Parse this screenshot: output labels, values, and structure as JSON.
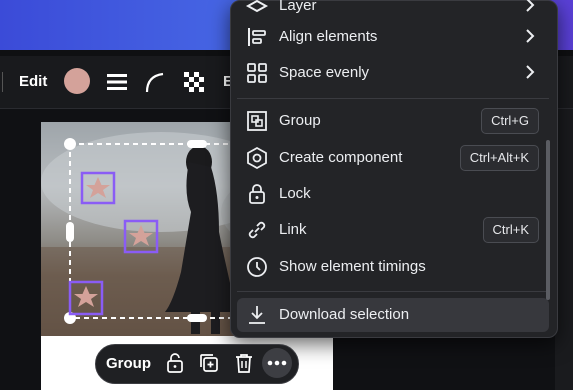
{
  "toolbar": {
    "edit_label": "Edit",
    "more_label": "E",
    "swatch_color": "#d4a29a"
  },
  "menu": {
    "partial_top_label": "Layer",
    "items": [
      {
        "label": "Align elements",
        "icon": "align-icon",
        "has_submenu": true
      },
      {
        "label": "Space evenly",
        "icon": "grid-icon",
        "has_submenu": true
      },
      {
        "label": "Group",
        "icon": "group-icon",
        "shortcut": "Ctrl+G"
      },
      {
        "label": "Create component",
        "icon": "component-icon",
        "shortcut": "Ctrl+Alt+K"
      },
      {
        "label": "Lock",
        "icon": "lock-icon"
      },
      {
        "label": "Link",
        "icon": "link-icon",
        "shortcut": "Ctrl+K"
      },
      {
        "label": "Show element timings",
        "icon": "clock-icon"
      },
      {
        "label": "Download selection",
        "icon": "download-icon",
        "highlighted": true
      }
    ]
  },
  "float_toolbar": {
    "group_label": "Group",
    "icons": [
      "unlock-icon",
      "duplicate-icon",
      "trash-icon",
      "more-icon"
    ]
  },
  "colors": {
    "menu_bg": "#232427",
    "selection": "#8a5cf5",
    "topbar": "#4a6fe8"
  }
}
